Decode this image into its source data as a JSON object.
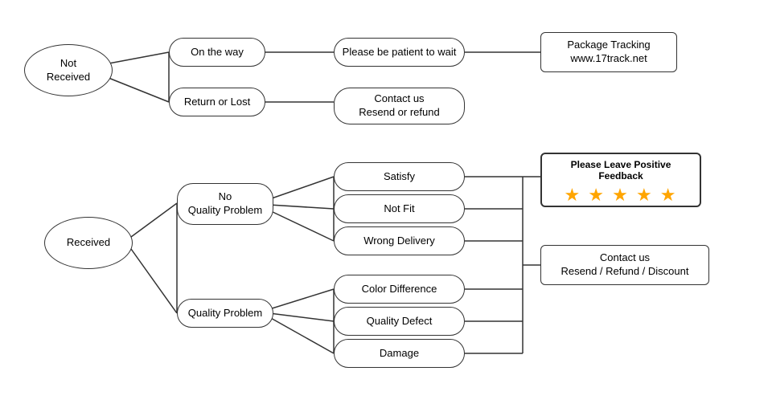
{
  "nodes": {
    "not_received": {
      "label": "Not\nReceived"
    },
    "on_the_way": {
      "label": "On the way"
    },
    "return_or_lost": {
      "label": "Return or Lost"
    },
    "patient": {
      "label": "Please be patient to wait"
    },
    "contact_resend_refund": {
      "label": "Contact us\nResend or refund"
    },
    "package_tracking": {
      "label": "Package Tracking\nwww.17track.net"
    },
    "received": {
      "label": "Received"
    },
    "no_quality_problem": {
      "label": "No\nQuality Problem"
    },
    "quality_problem": {
      "label": "Quality Problem"
    },
    "satisfy": {
      "label": "Satisfy"
    },
    "not_fit": {
      "label": "Not Fit"
    },
    "wrong_delivery": {
      "label": "Wrong Delivery"
    },
    "color_difference": {
      "label": "Color Difference"
    },
    "quality_defect": {
      "label": "Quality Defect"
    },
    "damage": {
      "label": "Damage"
    },
    "contact_resend_refund_discount": {
      "label": "Contact us\nResend / Refund / Discount"
    },
    "feedback": {
      "label": "Please Leave Positive Feedback"
    },
    "stars": {
      "value": "★ ★ ★ ★ ★"
    }
  }
}
